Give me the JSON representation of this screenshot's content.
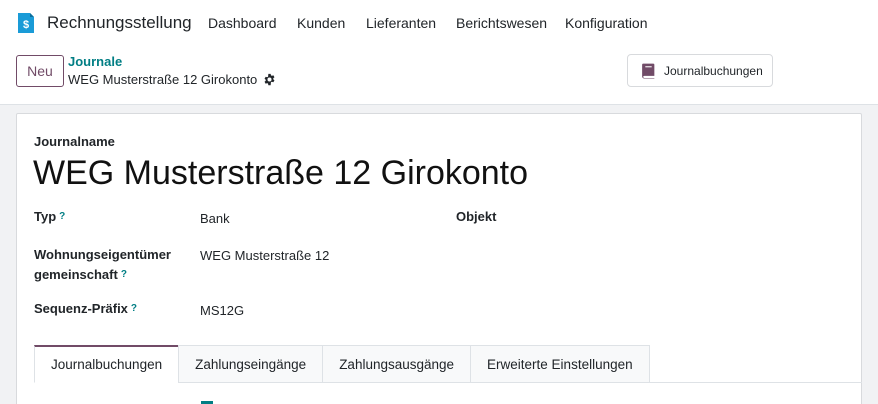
{
  "app": {
    "name": "Rechnungsstellung",
    "logo_icon": "invoicing-app-icon",
    "logo_symbol": "$"
  },
  "menu": [
    "Dashboard",
    "Kunden",
    "Lieferanten",
    "Berichtswesen",
    "Konfiguration"
  ],
  "control": {
    "new_label": "Neu",
    "breadcrumb_parent": "Journale",
    "breadcrumb_current": "WEG Musterstraße 12 Girokonto",
    "journal_entries_button": "Journalbuchungen"
  },
  "form": {
    "name_label": "Journalname",
    "name_value": "WEG Musterstraße 12 Girokonto",
    "fields": {
      "type_label": "Typ",
      "type_value": "Bank",
      "object_label": "Objekt",
      "community_label_line1": "Wohnungseigentümer",
      "community_label_line2": "gemeinschaft",
      "community_value": "WEG Musterstraße 12",
      "prefix_label": "Sequenz-Präfix",
      "prefix_value": "MS12G",
      "help_marker": "?"
    }
  },
  "tabs": [
    "Journalbuchungen",
    "Zahlungseingänge",
    "Zahlungsausgänge",
    "Erweiterte Einstellungen"
  ],
  "colors": {
    "brand": "#714b67",
    "link": "#017e84",
    "logo_blue": "#1a9bd7"
  }
}
